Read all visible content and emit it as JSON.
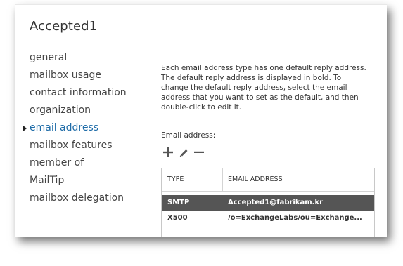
{
  "page": {
    "title": "Accepted1"
  },
  "nav": {
    "items": [
      {
        "label": "general"
      },
      {
        "label": "mailbox usage"
      },
      {
        "label": "contact information"
      },
      {
        "label": "organization"
      },
      {
        "label": "email address"
      },
      {
        "label": "mailbox features"
      },
      {
        "label": "member of"
      },
      {
        "label": "MailTip"
      },
      {
        "label": "mailbox delegation"
      }
    ],
    "active": "email address"
  },
  "content": {
    "description": "Each email address type has one default reply address. The default reply address is displayed in bold. To change the default reply address, select the email address that you want to set as the default, and then double-click to edit it.",
    "email_label": "Email address:",
    "toolbar": {
      "icons": [
        "add-icon",
        "edit-icon",
        "remove-icon"
      ]
    },
    "table": {
      "headers": {
        "type": "TYPE",
        "address": "EMAIL ADDRESS"
      },
      "rows": [
        {
          "type": "SMTP",
          "address": "Accepted1@fabrikam.kr",
          "selected": true
        },
        {
          "type": "X500",
          "address": "/o=ExchangeLabs/ou=Exchange...",
          "selected": false
        }
      ]
    }
  },
  "colors": {
    "accent": "#1f6ca8",
    "selected_row": "#555555",
    "text": "#333333"
  }
}
